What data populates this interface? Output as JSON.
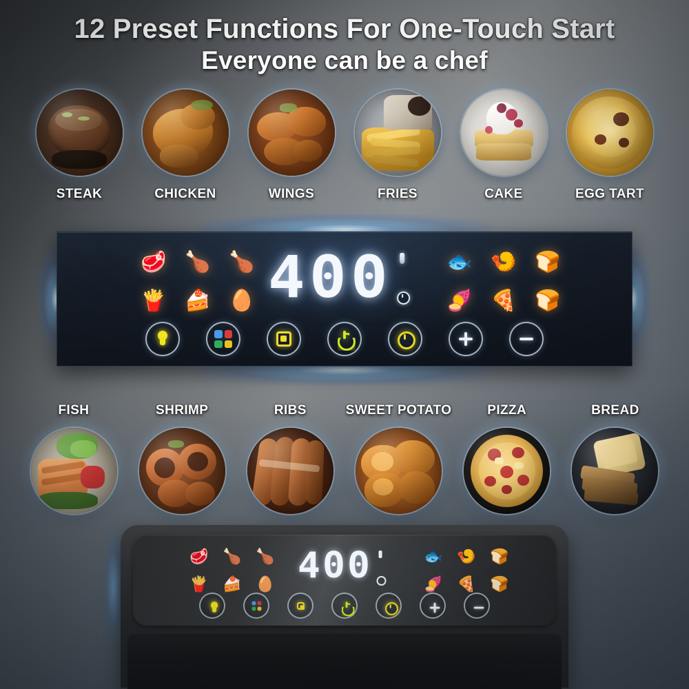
{
  "headline": {
    "line1": "12 Preset Functions For One-Touch Start",
    "line2": "Everyone can be a chef"
  },
  "colors": {
    "background_dark": "#2b2d2f",
    "background_light": "#8a8d8e",
    "panel_dark": "#10151d",
    "glow_blue": "#6eb9f5",
    "led_white": "#f4f8fc",
    "accent_yellow": "#eedb2a",
    "power_green": "#cfe81f"
  },
  "food_row_top": [
    {
      "label": "STEAK",
      "icon": "steak-icon",
      "emoji": "🥩"
    },
    {
      "label": "CHICKEN",
      "icon": "chicken-icon",
      "emoji": "🍗"
    },
    {
      "label": "WINGS",
      "icon": "wings-icon",
      "emoji": "🍖"
    },
    {
      "label": "FRIES",
      "icon": "fries-icon",
      "emoji": "🍟"
    },
    {
      "label": "CAKE",
      "icon": "cake-icon",
      "emoji": "🍰"
    },
    {
      "label": "EGG TART",
      "icon": "egg-tart-icon",
      "emoji": "🥚"
    }
  ],
  "food_row_bottom": [
    {
      "label": "FISH",
      "icon": "fish-icon",
      "emoji": "🐟"
    },
    {
      "label": "SHRIMP",
      "icon": "shrimp-icon",
      "emoji": "🍤"
    },
    {
      "label": "RIBS",
      "icon": "ribs-icon",
      "emoji": "🍖"
    },
    {
      "label": "SWEET POTATO",
      "icon": "sweet-potato-icon",
      "emoji": "🍠"
    },
    {
      "label": "PIZZA",
      "icon": "pizza-icon",
      "emoji": "🍕"
    },
    {
      "label": "BREAD",
      "icon": "bread-icon",
      "emoji": "🍞"
    }
  ],
  "control_panel": {
    "display_value": "400",
    "temp_indicator": "temperature-indicator",
    "timer_indicator": "timer-indicator",
    "presets_left": [
      {
        "name": "preset-steak",
        "emoji": "🥩"
      },
      {
        "name": "preset-chicken",
        "emoji": "🍗"
      },
      {
        "name": "preset-wings",
        "emoji": "🍗"
      },
      {
        "name": "preset-fries",
        "emoji": "🍟"
      },
      {
        "name": "preset-cake",
        "emoji": "🍰"
      },
      {
        "name": "preset-egg-tart",
        "emoji": "🥚"
      }
    ],
    "presets_right": [
      {
        "name": "preset-fish",
        "emoji": "🐟"
      },
      {
        "name": "preset-shrimp",
        "emoji": "🍤"
      },
      {
        "name": "preset-ribs",
        "emoji": "🍞"
      },
      {
        "name": "preset-sweet-potato",
        "emoji": "🍠"
      },
      {
        "name": "preset-pizza",
        "emoji": "🍕"
      },
      {
        "name": "preset-bread",
        "emoji": "🍞"
      }
    ],
    "buttons": [
      {
        "name": "light-button",
        "icon": "bulb-icon"
      },
      {
        "name": "menu-button",
        "icon": "menu-grid-icon"
      },
      {
        "name": "preset-button",
        "icon": "preset-square-icon"
      },
      {
        "name": "power-button",
        "icon": "power-icon"
      },
      {
        "name": "keep-warm-button",
        "icon": "timer-clock-icon"
      },
      {
        "name": "increase-button",
        "icon": "plus-icon"
      },
      {
        "name": "decrease-button",
        "icon": "minus-icon"
      }
    ]
  },
  "appliance": {
    "display_value": "400",
    "product": "air-fryer"
  }
}
